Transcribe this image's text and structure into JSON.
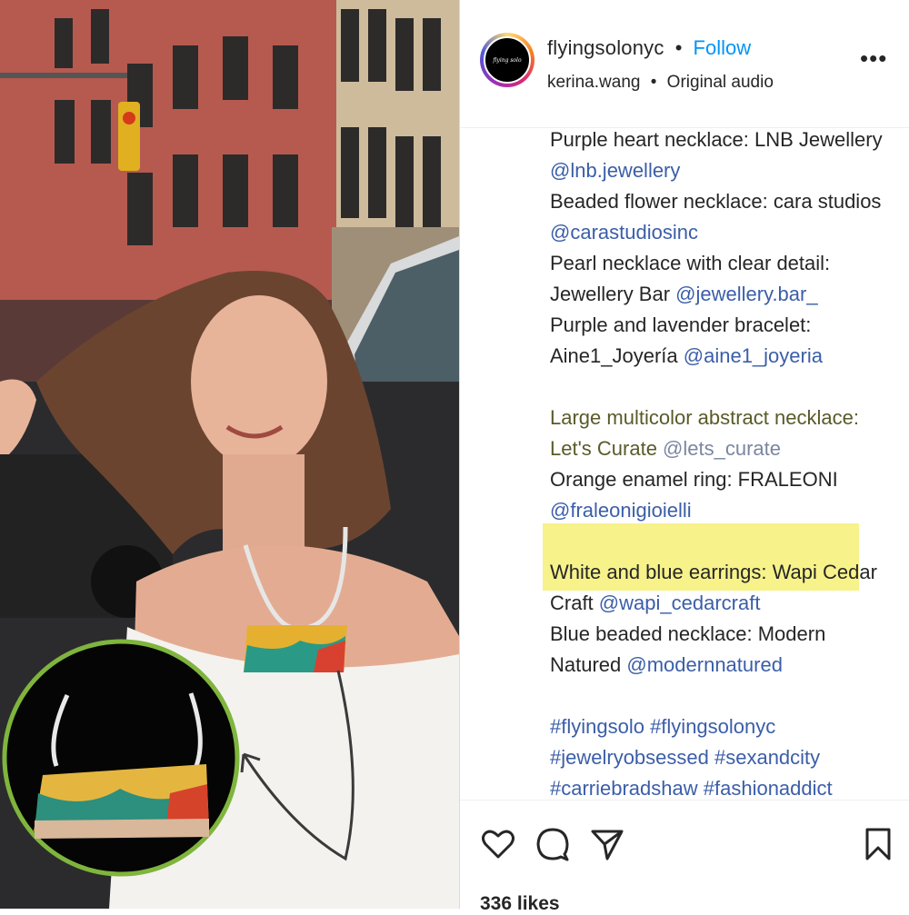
{
  "header": {
    "username": "flyingsolonyc",
    "separator": "•",
    "follow_label": "Follow",
    "audio_user": "kerina.wang",
    "audio_label": "Original audio",
    "more_label": "•••",
    "avatar_text": "flying solo"
  },
  "caption": {
    "lines": [
      {
        "text": "Purple heart necklace: LNB Jewellery"
      },
      {
        "link": "@lnb.jewellery"
      },
      {
        "text": "Beaded flower necklace: cara studios"
      },
      {
        "link": "@carastudiosinc"
      },
      {
        "text": "Pearl necklace with clear detail:"
      },
      {
        "text": "Jewellery Bar ",
        "link": "@jewellery.bar_"
      },
      {
        "text": "Purple and lavender bracelet:"
      },
      {
        "text": "Aine1_Joyería ",
        "link": "@aine1_joyeria"
      },
      {
        "text": "Large multicolor abstract necklace:"
      },
      {
        "text": "Let's Curate ",
        "link": "@lets_curate"
      },
      {
        "text": "Orange enamel ring: FRALEONI"
      },
      {
        "link": "@fraleonigioielli"
      },
      {
        "text": "White and blue earrings: Wapi Cedar"
      },
      {
        "text": "Craft ",
        "link": "@wapi_cedarcraft"
      },
      {
        "text": "Blue beaded necklace: Modern"
      },
      {
        "text": "Natured ",
        "link": "@modernnatured"
      },
      {
        "link": "#flyingsolo #flyingsolonyc"
      },
      {
        "link": "#jewelryobsessed #sexandcity"
      },
      {
        "link": "#carriebradshaw #fashionaddict"
      }
    ]
  },
  "likes": "336 likes",
  "colors": {
    "follow": "#0095f6",
    "link": "#3b5ea8",
    "highlight": "#f7f28a"
  }
}
